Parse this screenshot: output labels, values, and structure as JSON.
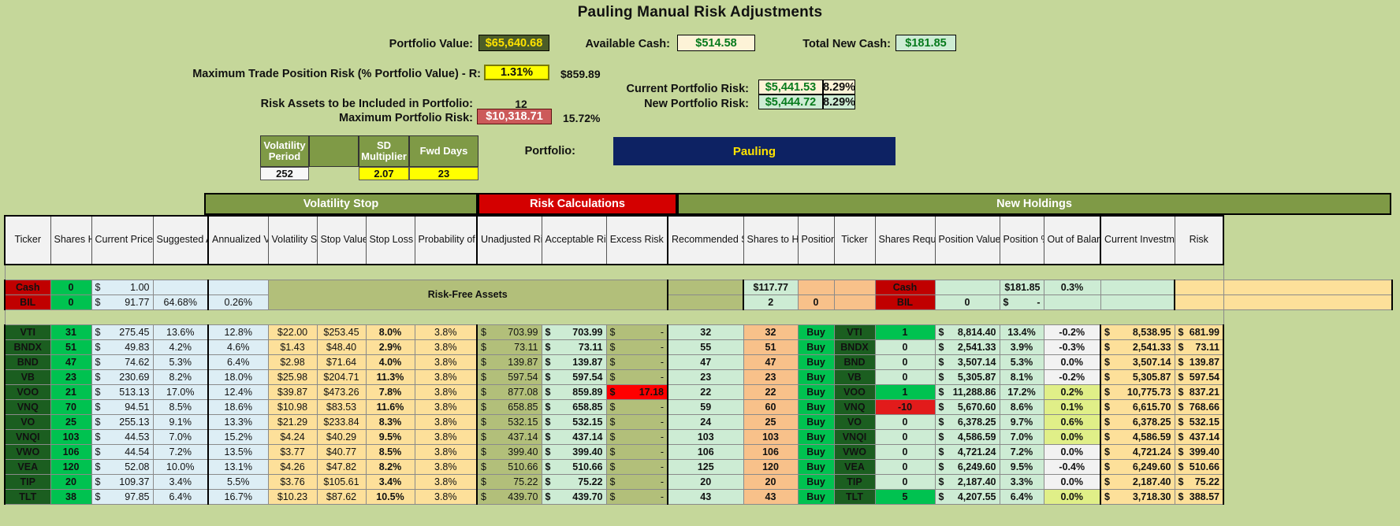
{
  "title": "Pauling Manual Risk Adjustments",
  "summary": {
    "portfolio_value_label": "Portfolio Value:",
    "portfolio_value": "$65,640.68",
    "available_cash_label": "Available Cash:",
    "available_cash": "$514.58",
    "total_new_cash_label": "Total New Cash:",
    "total_new_cash": "$181.85",
    "max_trade_risk_label": "Maximum Trade Position Risk (% Portfolio Value) - R:",
    "max_trade_risk_pct": "1.31%",
    "max_trade_risk_amt": "$859.89",
    "risk_assets_label": "Risk Assets to be Included in Portfolio:",
    "risk_assets_count": "12",
    "max_portfolio_risk_label": "Maximum Portfolio Risk:",
    "max_portfolio_risk": "$10,318.71",
    "max_portfolio_risk_pct": "15.72%",
    "current_portfolio_risk_label": "Current Portfolio Risk:",
    "current_portfolio_risk": "$5,441.53",
    "current_portfolio_risk_pct": "8.29%",
    "new_portfolio_risk_label": "New Portfolio Risk:",
    "new_portfolio_risk": "$5,444.72",
    "new_portfolio_risk_pct": "8.29%",
    "portfolio_label": "Portfolio:",
    "portfolio_name": "Pauling"
  },
  "vol_params": {
    "headers": [
      "Volatility Period",
      "",
      "SD Multiplier",
      "Fwd Days"
    ],
    "values": [
      "252",
      "",
      "2.07",
      "23"
    ]
  },
  "groups": {
    "volatility_stop": "Volatility Stop",
    "risk_calculations": "Risk Calculations",
    "new_holdings": "New Holdings"
  },
  "columns": [
    "Ticker",
    "Shares Held",
    "Current Price",
    "Suggested Allocation",
    "Annualized Volatility",
    "Volatility Stop",
    "Stop Value",
    "Stop Loss",
    "Probability of Stop",
    "Unadjusted Risk",
    "Acceptable Risk",
    "Excess Risk",
    "Recommended Shares from Auto",
    "Shares to Hold",
    "Position",
    "Ticker",
    "Shares Required",
    "Position Value",
    "Position %",
    "Out of Balance",
    "Current Investments",
    "Risk"
  ],
  "risk_free_label": "Risk-Free Assets",
  "risk_free": {
    "rows": [
      {
        "ticker": "Cash",
        "shares_held": "0",
        "price": "1.00",
        "alloc": "",
        "vol": "",
        "rec_shares": "$117.77",
        "shares_to_hold": "",
        "ticker2": "Cash",
        "shares_required": "",
        "position_value": "$181.85",
        "position_pct": "0.3%",
        "out_of_balance": "",
        "current_inv": "",
        "risk": ""
      },
      {
        "ticker": "BIL",
        "shares_held": "0",
        "price": "91.77",
        "alloc": "64.68%",
        "vol": "0.26%",
        "rec_shares": "2",
        "shares_to_hold": "0",
        "ticker2": "BIL",
        "shares_required": "0",
        "position_value": "-",
        "position_pct": "",
        "out_of_balance": "",
        "current_inv": "",
        "risk": ""
      }
    ]
  },
  "rows": [
    {
      "ticker": "VTI",
      "shares_held": "31",
      "price": "275.45",
      "alloc": "13.6%",
      "ann_vol": "12.8%",
      "vol_stop": "$22.00",
      "stop_value": "$253.45",
      "stop_loss": "8.0%",
      "prob_stop": "3.8%",
      "unadj_risk": "703.99",
      "accept_risk": "703.99",
      "excess_risk": "-",
      "excess_flag": false,
      "rec_shares": "32",
      "shares_to_hold": "32",
      "position": "Buy",
      "ticker2": "VTI",
      "shares_required": "1",
      "shares_req_state": "green",
      "position_value": "8,814.40",
      "position_pct": "13.4%",
      "out_of_balance": "-0.2%",
      "oob_flag": false,
      "current_inv": "8,538.95",
      "risk": "681.99"
    },
    {
      "ticker": "BNDX",
      "shares_held": "51",
      "price": "49.83",
      "alloc": "4.2%",
      "ann_vol": "4.6%",
      "vol_stop": "$1.43",
      "stop_value": "$48.40",
      "stop_loss": "2.9%",
      "prob_stop": "3.8%",
      "unadj_risk": "73.11",
      "accept_risk": "73.11",
      "excess_risk": "-",
      "excess_flag": false,
      "rec_shares": "55",
      "shares_to_hold": "51",
      "position": "Buy",
      "ticker2": "BNDX",
      "shares_required": "0",
      "shares_req_state": "pale",
      "position_value": "2,541.33",
      "position_pct": "3.9%",
      "out_of_balance": "-0.3%",
      "oob_flag": false,
      "current_inv": "2,541.33",
      "risk": "73.11"
    },
    {
      "ticker": "BND",
      "shares_held": "47",
      "price": "74.62",
      "alloc": "5.3%",
      "ann_vol": "6.4%",
      "vol_stop": "$2.98",
      "stop_value": "$71.64",
      "stop_loss": "4.0%",
      "prob_stop": "3.8%",
      "unadj_risk": "139.87",
      "accept_risk": "139.87",
      "excess_risk": "-",
      "excess_flag": false,
      "rec_shares": "47",
      "shares_to_hold": "47",
      "position": "Buy",
      "ticker2": "BND",
      "shares_required": "0",
      "shares_req_state": "pale",
      "position_value": "3,507.14",
      "position_pct": "5.3%",
      "out_of_balance": "0.0%",
      "oob_flag": false,
      "current_inv": "3,507.14",
      "risk": "139.87"
    },
    {
      "ticker": "VB",
      "shares_held": "23",
      "price": "230.69",
      "alloc": "8.2%",
      "ann_vol": "18.0%",
      "vol_stop": "$25.98",
      "stop_value": "$204.71",
      "stop_loss": "11.3%",
      "prob_stop": "3.8%",
      "unadj_risk": "597.54",
      "accept_risk": "597.54",
      "excess_risk": "-",
      "excess_flag": false,
      "rec_shares": "23",
      "shares_to_hold": "23",
      "position": "Buy",
      "ticker2": "VB",
      "shares_required": "0",
      "shares_req_state": "pale",
      "position_value": "5,305.87",
      "position_pct": "8.1%",
      "out_of_balance": "-0.2%",
      "oob_flag": false,
      "current_inv": "5,305.87",
      "risk": "597.54"
    },
    {
      "ticker": "VOO",
      "shares_held": "21",
      "price": "513.13",
      "alloc": "17.0%",
      "ann_vol": "12.4%",
      "vol_stop": "$39.87",
      "stop_value": "$473.26",
      "stop_loss": "7.8%",
      "prob_stop": "3.8%",
      "unadj_risk": "877.08",
      "accept_risk": "859.89",
      "excess_risk": "17.18",
      "excess_flag": true,
      "rec_shares": "22",
      "shares_to_hold": "22",
      "position": "Buy",
      "ticker2": "VOO",
      "shares_required": "1",
      "shares_req_state": "green",
      "position_value": "11,288.86",
      "position_pct": "17.2%",
      "out_of_balance": "0.2%",
      "oob_flag": true,
      "current_inv": "10,775.73",
      "risk": "837.21"
    },
    {
      "ticker": "VNQ",
      "shares_held": "70",
      "price": "94.51",
      "alloc": "8.5%",
      "ann_vol": "18.6%",
      "vol_stop": "$10.98",
      "stop_value": "$83.53",
      "stop_loss": "11.6%",
      "prob_stop": "3.8%",
      "unadj_risk": "658.85",
      "accept_risk": "658.85",
      "excess_risk": "-",
      "excess_flag": false,
      "rec_shares": "59",
      "shares_to_hold": "60",
      "position": "Buy",
      "ticker2": "VNQ",
      "shares_required": "-10",
      "shares_req_state": "red",
      "position_value": "5,670.60",
      "position_pct": "8.6%",
      "out_of_balance": "0.1%",
      "oob_flag": true,
      "current_inv": "6,615.70",
      "risk": "768.66"
    },
    {
      "ticker": "VO",
      "shares_held": "25",
      "price": "255.13",
      "alloc": "9.1%",
      "ann_vol": "13.3%",
      "vol_stop": "$21.29",
      "stop_value": "$233.84",
      "stop_loss": "8.3%",
      "prob_stop": "3.8%",
      "unadj_risk": "532.15",
      "accept_risk": "532.15",
      "excess_risk": "-",
      "excess_flag": false,
      "rec_shares": "24",
      "shares_to_hold": "25",
      "position": "Buy",
      "ticker2": "VO",
      "shares_required": "0",
      "shares_req_state": "pale",
      "position_value": "6,378.25",
      "position_pct": "9.7%",
      "out_of_balance": "0.6%",
      "oob_flag": true,
      "current_inv": "6,378.25",
      "risk": "532.15"
    },
    {
      "ticker": "VNQI",
      "shares_held": "103",
      "price": "44.53",
      "alloc": "7.0%",
      "ann_vol": "15.2%",
      "vol_stop": "$4.24",
      "stop_value": "$40.29",
      "stop_loss": "9.5%",
      "prob_stop": "3.8%",
      "unadj_risk": "437.14",
      "accept_risk": "437.14",
      "excess_risk": "-",
      "excess_flag": false,
      "rec_shares": "103",
      "shares_to_hold": "103",
      "position": "Buy",
      "ticker2": "VNQI",
      "shares_required": "0",
      "shares_req_state": "pale",
      "position_value": "4,586.59",
      "position_pct": "7.0%",
      "out_of_balance": "0.0%",
      "oob_flag": true,
      "current_inv": "4,586.59",
      "risk": "437.14"
    },
    {
      "ticker": "VWO",
      "shares_held": "106",
      "price": "44.54",
      "alloc": "7.2%",
      "ann_vol": "13.5%",
      "vol_stop": "$3.77",
      "stop_value": "$40.77",
      "stop_loss": "8.5%",
      "prob_stop": "3.8%",
      "unadj_risk": "399.40",
      "accept_risk": "399.40",
      "excess_risk": "-",
      "excess_flag": false,
      "rec_shares": "106",
      "shares_to_hold": "106",
      "position": "Buy",
      "ticker2": "VWO",
      "shares_required": "0",
      "shares_req_state": "pale",
      "position_value": "4,721.24",
      "position_pct": "7.2%",
      "out_of_balance": "0.0%",
      "oob_flag": false,
      "current_inv": "4,721.24",
      "risk": "399.40"
    },
    {
      "ticker": "VEA",
      "shares_held": "120",
      "price": "52.08",
      "alloc": "10.0%",
      "ann_vol": "13.1%",
      "vol_stop": "$4.26",
      "stop_value": "$47.82",
      "stop_loss": "8.2%",
      "prob_stop": "3.8%",
      "unadj_risk": "510.66",
      "accept_risk": "510.66",
      "excess_risk": "-",
      "excess_flag": false,
      "rec_shares": "125",
      "shares_to_hold": "120",
      "position": "Buy",
      "ticker2": "VEA",
      "shares_required": "0",
      "shares_req_state": "pale",
      "position_value": "6,249.60",
      "position_pct": "9.5%",
      "out_of_balance": "-0.4%",
      "oob_flag": false,
      "current_inv": "6,249.60",
      "risk": "510.66"
    },
    {
      "ticker": "TIP",
      "shares_held": "20",
      "price": "109.37",
      "alloc": "3.4%",
      "ann_vol": "5.5%",
      "vol_stop": "$3.76",
      "stop_value": "$105.61",
      "stop_loss": "3.4%",
      "prob_stop": "3.8%",
      "unadj_risk": "75.22",
      "accept_risk": "75.22",
      "excess_risk": "-",
      "excess_flag": false,
      "rec_shares": "20",
      "shares_to_hold": "20",
      "position": "Buy",
      "ticker2": "TIP",
      "shares_required": "0",
      "shares_req_state": "pale",
      "position_value": "2,187.40",
      "position_pct": "3.3%",
      "out_of_balance": "0.0%",
      "oob_flag": false,
      "current_inv": "2,187.40",
      "risk": "75.22"
    },
    {
      "ticker": "TLT",
      "shares_held": "38",
      "price": "97.85",
      "alloc": "6.4%",
      "ann_vol": "16.7%",
      "vol_stop": "$10.23",
      "stop_value": "$87.62",
      "stop_loss": "10.5%",
      "prob_stop": "3.8%",
      "unadj_risk": "439.70",
      "accept_risk": "439.70",
      "excess_risk": "-",
      "excess_flag": false,
      "rec_shares": "43",
      "shares_to_hold": "43",
      "position": "Buy",
      "ticker2": "TLT",
      "shares_required": "5",
      "shares_req_state": "green",
      "position_value": "4,207.55",
      "position_pct": "6.4%",
      "out_of_balance": "0.0%",
      "oob_flag": true,
      "current_inv": "3,718.30",
      "risk": "388.57"
    }
  ],
  "colors": {
    "sheet_bg": "#c5d79a",
    "olive_band": "#7f9a46",
    "risk_band_red": "#d40000",
    "ticker_green": "#1b5e20",
    "ticker_red": "#c00000",
    "accent_yellow": "#ffff00",
    "portfolio_navy": "#0d2263"
  }
}
